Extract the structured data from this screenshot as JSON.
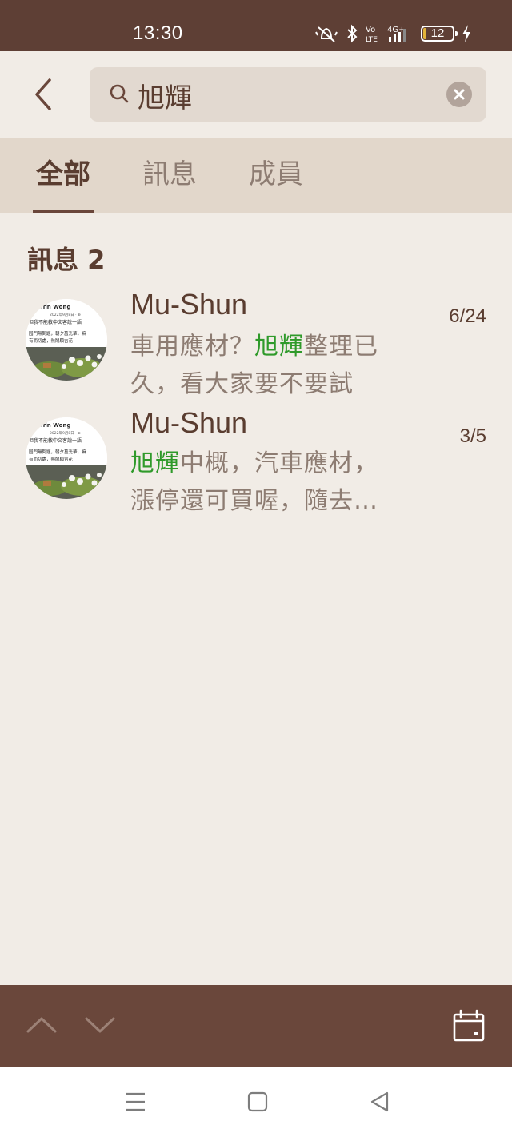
{
  "status_bar": {
    "time": "13:30",
    "network": "4G+",
    "volte": "Vo LTE",
    "battery": "12"
  },
  "search": {
    "query": "旭輝",
    "placeholder": ""
  },
  "tabs": [
    {
      "label": "全部",
      "active": true
    },
    {
      "label": "訊息",
      "active": false
    },
    {
      "label": "成員",
      "active": false
    }
  ],
  "section": {
    "title": "訊息 2"
  },
  "messages": [
    {
      "sender": "Mu-Shun",
      "date": "6/24",
      "line1_before": "車用應材？",
      "line1_highlight": "旭輝",
      "line1_after": "整理已",
      "line2": "久，看大家要不要試"
    },
    {
      "sender": "Mu-Shun",
      "date": "3/5",
      "line1_before": "",
      "line1_highlight": "旭輝",
      "line1_after": "中概，汽車應材，",
      "line2": "漲停還可買喔，隨去…"
    }
  ],
  "avatar_text": {
    "name": "uffin Wong",
    "date": "2022年9月8日 · ⊕",
    "caption1": "但我不能教中文客說一語",
    "caption2": "园門無問題，朝夕菖光華，嘛",
    "caption3": "有而切處，熱鬧願吉花"
  },
  "colors": {
    "brand_brown": "#6a473b",
    "highlight_green": "#2f9a2a",
    "background": "#f1ece6"
  },
  "icons": {
    "back": "chevron-left-icon",
    "search": "search-icon",
    "clear": "close-circle-icon",
    "prev": "chevron-up-icon",
    "next": "chevron-down-icon",
    "calendar": "calendar-icon",
    "recents": "menu-icon",
    "home": "square-icon",
    "system_back": "triangle-back-icon"
  }
}
